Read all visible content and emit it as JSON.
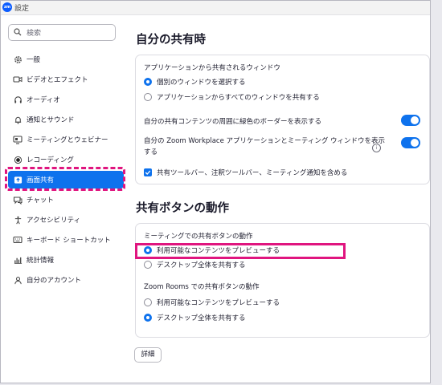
{
  "window": {
    "title": "設定",
    "app_icon": "zm"
  },
  "search": {
    "placeholder": "検索"
  },
  "sidebar": {
    "items": [
      {
        "label": "一般",
        "icon": "gear-icon"
      },
      {
        "label": "ビデオとエフェクト",
        "icon": "video-icon"
      },
      {
        "label": "オーディオ",
        "icon": "headphones-icon"
      },
      {
        "label": "通知とサウンド",
        "icon": "bell-icon"
      },
      {
        "label": "ミーティングとウェビナー",
        "icon": "meeting-icon"
      },
      {
        "label": "レコーディング",
        "icon": "record-icon"
      },
      {
        "label": "画面共有",
        "icon": "share-screen-icon",
        "active": true
      },
      {
        "label": "チャット",
        "icon": "chat-icon"
      },
      {
        "label": "アクセシビリティ",
        "icon": "accessibility-icon"
      },
      {
        "label": "キーボード ショートカット",
        "icon": "keyboard-icon"
      },
      {
        "label": "統計情報",
        "icon": "stats-icon"
      },
      {
        "label": "自分のアカウント",
        "icon": "account-icon"
      }
    ]
  },
  "my_share": {
    "title": "自分の共有時",
    "window_group_label": "アプリケーションから共有されるウィンドウ",
    "option_individual": "個別のウィンドウを選択する",
    "option_all": "アプリケーションからすべてのウィンドウを共有する",
    "green_border_label": "自分の共有コンテンツの周囲に緑色のボーダーを表示する",
    "zoom_workplace_label_line1": "自分の Zoom Workplace アプリケーションとミーティング ウィンドウを表示",
    "zoom_workplace_label_line2": "する",
    "toolbar_label": "共有ツールバー、注釈ツールバー、ミーティング通知を含める"
  },
  "share_button": {
    "title": "共有ボタンの動作",
    "meeting_label": "ミーティングでの共有ボタンの動作",
    "meeting_preview": "利用可能なコンテンツをプレビューする",
    "meeting_desktop": "デスクトップ全体を共有する",
    "rooms_label": "Zoom Rooms での共有ボタンの動作",
    "rooms_preview": "利用可能なコンテンツをプレビューする",
    "rooms_desktop": "デスクトップ全体を共有する"
  },
  "details_button": "詳細",
  "colors": {
    "accent": "#0e72ed",
    "highlight": "#e0157f"
  }
}
